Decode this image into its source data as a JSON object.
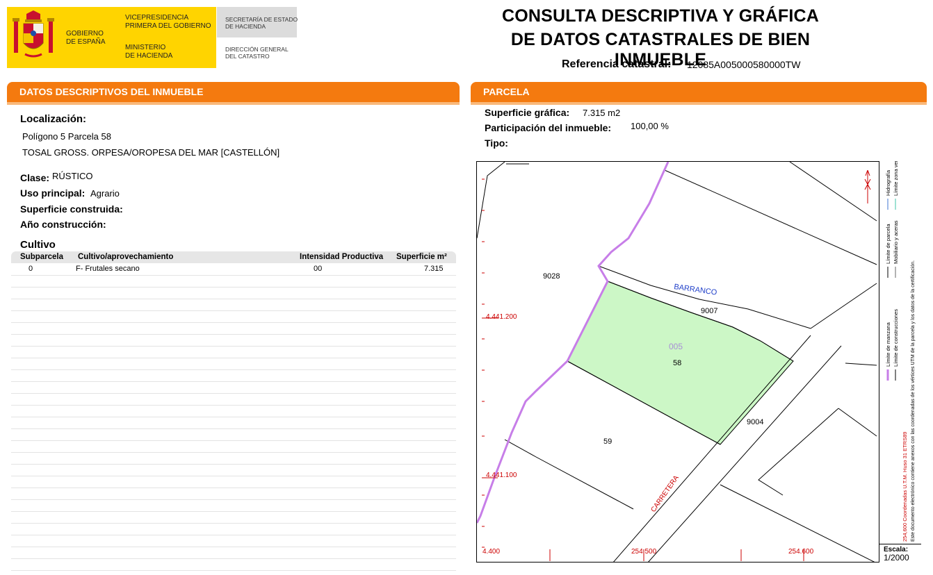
{
  "header": {
    "logo": {
      "gobierno": [
        "GOBIERNO",
        "DE ESPAÑA"
      ],
      "vicepresidencia": [
        "VICEPRESIDENCIA",
        "PRIMERA DEL GOBIERNO"
      ],
      "ministerio": [
        "MINISTERIO",
        "DE HACIENDA"
      ],
      "secretaria": [
        "SECRETARÍA DE ESTADO",
        "DE HACIENDA"
      ],
      "direccion": [
        "DIRECCIÓN GENERAL",
        "DEL CATASTRO"
      ],
      "colors": {
        "yellow": "#ffd400",
        "gray": "#dcdcdc"
      }
    },
    "title_line1": "CONSULTA DESCRIPTIVA Y GRÁFICA",
    "title_line2": "DE DATOS CATASTRALES DE BIEN INMUEBLE",
    "ref_label": "Referencia catastral:",
    "ref_value": "12085A005000580000TW"
  },
  "left_section": {
    "bar_title": "DATOS DESCRIPTIVOS DEL INMUEBLE",
    "localizacion_label": "Localización:",
    "localizacion_line1": "Polígono 5 Parcela 58",
    "localizacion_line2": "TOSAL GROSS. ORPESA/OROPESA DEL MAR [CASTELLÓN]",
    "clase_label": "Clase:",
    "clase_value": "RÚSTICO",
    "uso_label": "Uso principal:",
    "uso_value": "Agrario",
    "superficie_label": "Superficie construida:",
    "anio_label": "Año construcción:",
    "cultivo_title": "Cultivo",
    "cultivo_table": {
      "headers": [
        "Subparcela",
        "Cultivo/aprovechamiento",
        "Intensidad Productiva",
        "Superficie m²"
      ],
      "rows": [
        {
          "subparcela": "0",
          "cultivo": "F- Frutales secano",
          "intensidad": "00",
          "superficie": "7.315"
        }
      ]
    }
  },
  "right_section": {
    "bar_title": "PARCELA",
    "superficie_grafica_label": "Superficie gráfica:",
    "superficie_grafica_value": "7.315 m2",
    "participacion_label": "Participación del inmueble:",
    "participacion_value": "100,00 %",
    "tipo_label": "Tipo:"
  },
  "map": {
    "parcel_labels": {
      "p9028": "9028",
      "p9007": "9007",
      "p005": "005",
      "p58": "58",
      "p9004": "9004",
      "p59": "59"
    },
    "street_labels": {
      "barranco": "BARRANCO",
      "carretera": "CARRETERA"
    },
    "coord_labels": {
      "y1": "4.441.200",
      "y2": "4.441.100",
      "x0": "4.400",
      "x1": "254.500",
      "x2": "254.600"
    },
    "legend": {
      "col1_a": "Límite de manzana",
      "col1_b": "Límite de parcela",
      "col1_c": "Hidrografía",
      "col2_a": "Límite de construcciones",
      "col2_b": "Mobiliario y aceras",
      "col2_c": "Límite zona verde",
      "coords": "254,600 Coordenadas U.T.M. Huso 31 ETRS89",
      "note": "Este documento electrónico contiene anexos con las coordenadas de los vértices UTM de la parcela y los datos de la certificación."
    },
    "scale_label": "Escala:",
    "scale_value": "1/2000",
    "colors": {
      "parcel_fill": "#ccf7c6",
      "manzana_line": "#c77ee8",
      "coord_text": "#cc0000",
      "barranco_text": "#1f3fc9",
      "selected_number": "#a98fd6"
    }
  }
}
